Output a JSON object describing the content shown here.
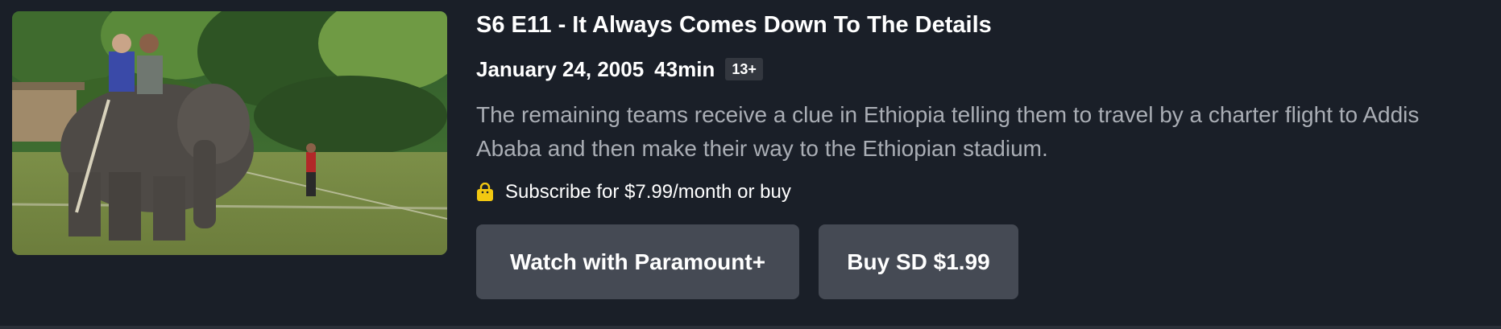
{
  "episode": {
    "thumbnail": {
      "icon": "episode-thumbnail"
    },
    "title": "S6 E11 - It Always Comes Down To The Details",
    "air_date": "January 24, 2005",
    "duration": "43min",
    "rating": "13+",
    "description": "The remaining teams receive a clue in Ethiopia telling them to travel by a charter flight to Addis Ababa and then make their way to the Ethiopian stadium.",
    "offer": {
      "icon": "shopping-bag-icon",
      "text": "Subscribe for $7.99/month or buy"
    },
    "buttons": {
      "watch_label": "Watch with Paramount+",
      "buy_label": "Buy SD $1.99"
    }
  },
  "colors": {
    "background": "#1a1f28",
    "button": "#454a54",
    "badge": "#33373f",
    "description_text": "#aaaeb5",
    "bag_icon": "#f2c811"
  }
}
